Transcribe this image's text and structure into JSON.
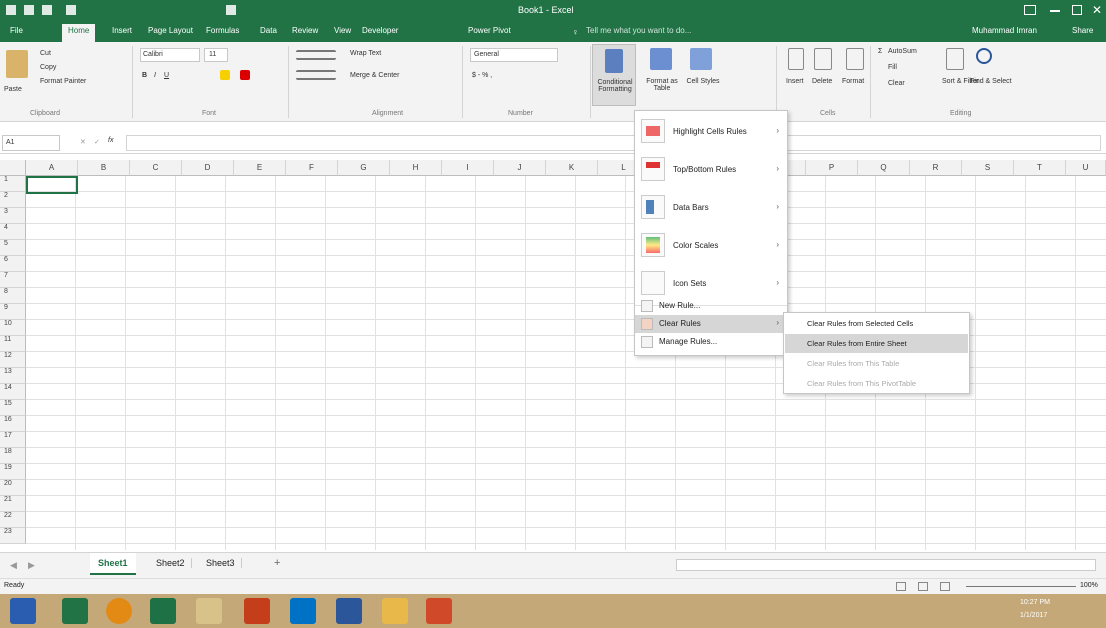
{
  "titlebar": {
    "title": "Book1 - Excel",
    "tell_me": "Tell me what you want to do...",
    "user": "Muhammad Imran",
    "share": "Share"
  },
  "tabs": [
    "File",
    "Home",
    "Insert",
    "Page Layout",
    "Formulas",
    "Data",
    "Review",
    "View",
    "Developer",
    "Power Pivot"
  ],
  "ribbon": {
    "clipboard": {
      "paste": "Paste",
      "cut": "Cut",
      "copy": "Copy",
      "format_painter": "Format Painter",
      "label": "Clipboard"
    },
    "font": {
      "name": "Calibri",
      "size": "11",
      "label": "Font"
    },
    "alignment": {
      "wrap": "Wrap Text",
      "merge": "Merge & Center",
      "label": "Alignment"
    },
    "number": {
      "format": "General",
      "label": "Number"
    },
    "styles": {
      "conditional": "Conditional Formatting",
      "format_as_table": "Format as Table",
      "cell_styles": "Cell Styles"
    },
    "cells": {
      "insert": "Insert",
      "delete": "Delete",
      "format": "Format",
      "label": "Cells"
    },
    "editing": {
      "autosum": "AutoSum",
      "fill": "Fill",
      "clear": "Clear",
      "sort": "Sort & Filter",
      "find": "Find & Select",
      "label": "Editing"
    }
  },
  "formula_bar": {
    "name_box": "A1",
    "fx": "fx",
    "value": ""
  },
  "columns": [
    "A",
    "B",
    "C",
    "D",
    "E",
    "F",
    "G",
    "H",
    "I",
    "J",
    "K",
    "L",
    "M",
    "N",
    "O",
    "P",
    "Q",
    "R",
    "S",
    "T",
    "U"
  ],
  "rows": [
    "1",
    "2",
    "3",
    "4",
    "5",
    "6",
    "7",
    "8",
    "9",
    "10",
    "11",
    "12",
    "13",
    "14",
    "15",
    "16",
    "17",
    "18",
    "19",
    "20",
    "21",
    "22",
    "23"
  ],
  "cf_menu": {
    "items": [
      {
        "label": "Highlight Cells Rules",
        "arrow": "›"
      },
      {
        "label": "Top/Bottom Rules",
        "arrow": "›"
      },
      {
        "label": "Data Bars",
        "arrow": "›"
      },
      {
        "label": "Color Scales",
        "arrow": "›"
      },
      {
        "label": "Icon Sets",
        "arrow": "›"
      }
    ],
    "new_rule": "New Rule...",
    "clear_rules": "Clear Rules",
    "clear_arrow": "›",
    "manage": "Manage Rules..."
  },
  "submenu": {
    "items": [
      {
        "label": "Clear Rules from Selected Cells"
      },
      {
        "label": "Clear Rules from Entire Sheet"
      },
      {
        "label": "Clear Rules from This Table"
      },
      {
        "label": "Clear Rules from This PivotTable"
      }
    ]
  },
  "sheets": [
    "Sheet1",
    "Sheet2",
    "Sheet3"
  ],
  "add_sheet": "+",
  "status": {
    "ready": "Ready",
    "zoom": "100%"
  },
  "taskbar": {
    "time": "10:27 PM",
    "date": "1/1/2017"
  },
  "colors": {
    "excel_green": "#217346",
    "ribbon_bg": "#f3f3f3",
    "hover": "#e0e0e0"
  }
}
